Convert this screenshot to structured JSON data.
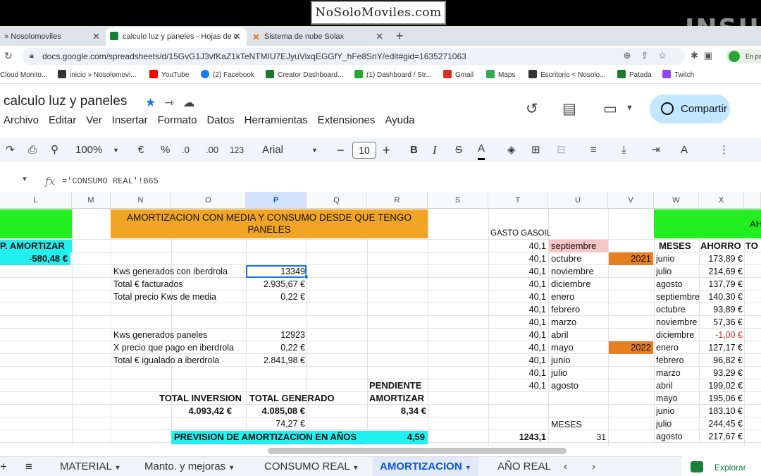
{
  "watermark": "NoSoloMoviles.com",
  "browser": {
    "tabs": [
      {
        "label": "» Nosolomoviles"
      },
      {
        "label": "calculo luz y paneles - Hojas de c"
      },
      {
        "label": "Sistema de nube Solax"
      }
    ],
    "url": "docs.google.com/spreadsheets/d/15GvG1J3vfKaZ1kTeNTMIU7EJyuVixqEGGfY_hFe8SnY/edit#gid=1635271063",
    "profile_label": "En pa",
    "bookmarks": [
      {
        "label": "Cloud Monito...",
        "color": "#4285f4"
      },
      {
        "label": "inicio » Nosolomovi...",
        "color": "#333333"
      },
      {
        "label": "YouTube",
        "color": "#ff0000"
      },
      {
        "label": "(2) Facebook",
        "color": "#1877f2"
      },
      {
        "label": "Creator Dashboard...",
        "color": "#1a7a2a"
      },
      {
        "label": "(1) Dashboard / Str...",
        "color": "#2ca43a"
      },
      {
        "label": "Gmail",
        "color": "#d93025"
      },
      {
        "label": "Maps",
        "color": "#34a853"
      },
      {
        "label": "Escritorio < Nosolo...",
        "color": "#333333"
      },
      {
        "label": "Patada",
        "color": "#1a7a2a"
      },
      {
        "label": "Twitch",
        "color": "#9146ff"
      }
    ]
  },
  "doc": {
    "title": "calculo luz y paneles",
    "menu": [
      "Archivo",
      "Editar",
      "Ver",
      "Insertar",
      "Formato",
      "Datos",
      "Herramientas",
      "Extensiones",
      "Ayuda"
    ],
    "share_label": "Compartir"
  },
  "toolbar": {
    "zoom": "100%",
    "currency": "€",
    "percent": "%",
    "dec_less": ".0",
    "dec_more": ".00",
    "number_format": "123",
    "font": "Arial",
    "font_size": "10"
  },
  "formula_bar": {
    "fx": "fx",
    "formula": "='CONSUMO REAL'!B65"
  },
  "columns": [
    "L",
    "M",
    "N",
    "O",
    "P",
    "Q",
    "R",
    "S",
    "T",
    "U",
    "V",
    "W",
    "X"
  ],
  "sheet": {
    "amortizar_header": "P. AMORTIZAR",
    "amortizar_value": "-580,48 €",
    "block_title": "AMORTIZACION CON MEDIA Y CONSUMO DESDE QUE TENGO PANELES",
    "labels": {
      "kws_iberdrola": "Kws generados con iberdrola",
      "total_facturados": "Total € facturados",
      "precio_media": "Total precio Kws de media",
      "kws_paneles": "Kws generados paneles",
      "precio_pago": "X precio que pago en iberdrola",
      "total_igualado": "Total € igualado a iberdrola"
    },
    "values": {
      "kws_iberdrola": "13349",
      "total_facturados": "2.935,67 €",
      "precio_media": "0,22 €",
      "kws_paneles": "12923",
      "precio_pago": "0,22 €",
      "total_igualado": "2.841,98 €"
    },
    "totals": {
      "inversion_label": "TOTAL INVERSION",
      "inversion_value": "4.093,42 €",
      "generado_label": "TOTAL GENERADO",
      "generado_value": "4.085,08 €",
      "pendiente_label_1": "PENDIENTE",
      "pendiente_label_2": "AMORTIZAR",
      "pendiente_value": "8,34 €",
      "extra_value": "74,27 €",
      "prevision_label": "PREVISION DE AMORTIZACION EN AÑOS",
      "prevision_value": "4,59"
    },
    "gasoil": {
      "header": "GASTO GASOIL",
      "rows": [
        {
          "value": "40,1",
          "month": "septiembre"
        },
        {
          "value": "40,1",
          "month": "octubre"
        },
        {
          "value": "40,1",
          "month": "noviembre"
        },
        {
          "value": "40,1",
          "month": "diciembre"
        },
        {
          "value": "40,1",
          "month": "enero"
        },
        {
          "value": "40,1",
          "month": "febrero"
        },
        {
          "value": "40,1",
          "month": "marzo"
        },
        {
          "value": "40,1",
          "month": "abril"
        },
        {
          "value": "40,1",
          "month": "mayo"
        },
        {
          "value": "40,1",
          "month": "junio"
        },
        {
          "value": "40,1",
          "month": "julio"
        },
        {
          "value": "40,1",
          "month": "agosto"
        }
      ],
      "meses_label": "MESES",
      "total": "1243,1",
      "meses_value": "31",
      "year1": "2021",
      "year2": "2022"
    },
    "ahorro": {
      "banner": "AH",
      "h_meses": "MESES",
      "h_ahorro": "AHORRO",
      "h_total": "TO",
      "rows": [
        {
          "month": "junio",
          "value": "173,89 €"
        },
        {
          "month": "julio",
          "value": "214,69 €"
        },
        {
          "month": "agosto",
          "value": "137,79 €"
        },
        {
          "month": "septiembre",
          "value": "140,30 €"
        },
        {
          "month": "octubre",
          "value": "93,89 €"
        },
        {
          "month": "noviembre",
          "value": "57,36 €"
        },
        {
          "month": "diciembre",
          "value": "-1,00 €"
        },
        {
          "month": "enero",
          "value": "127,17 €"
        },
        {
          "month": "febrero",
          "value": "96,82 €"
        },
        {
          "month": "marzo",
          "value": "93,29 €"
        },
        {
          "month": "abril",
          "value": "199,02 €"
        },
        {
          "month": "mayo",
          "value": "195,06 €"
        },
        {
          "month": "junio",
          "value": "183,10 €"
        },
        {
          "month": "julio",
          "value": "244,45 €"
        },
        {
          "month": "agosto",
          "value": "217,67 €"
        }
      ]
    }
  },
  "sheet_tabs": [
    "MATERIAL",
    "Manto. y mejoras",
    "CONSUMO REAL",
    "AMORTIZACION",
    "AÑO REAL"
  ],
  "explorar": "Explorar",
  "colors": {
    "green": "#22ee22",
    "cyan": "#22f0f0",
    "orange": "#f0a624",
    "negative": "#d93025",
    "accent": "#1a73e8"
  }
}
